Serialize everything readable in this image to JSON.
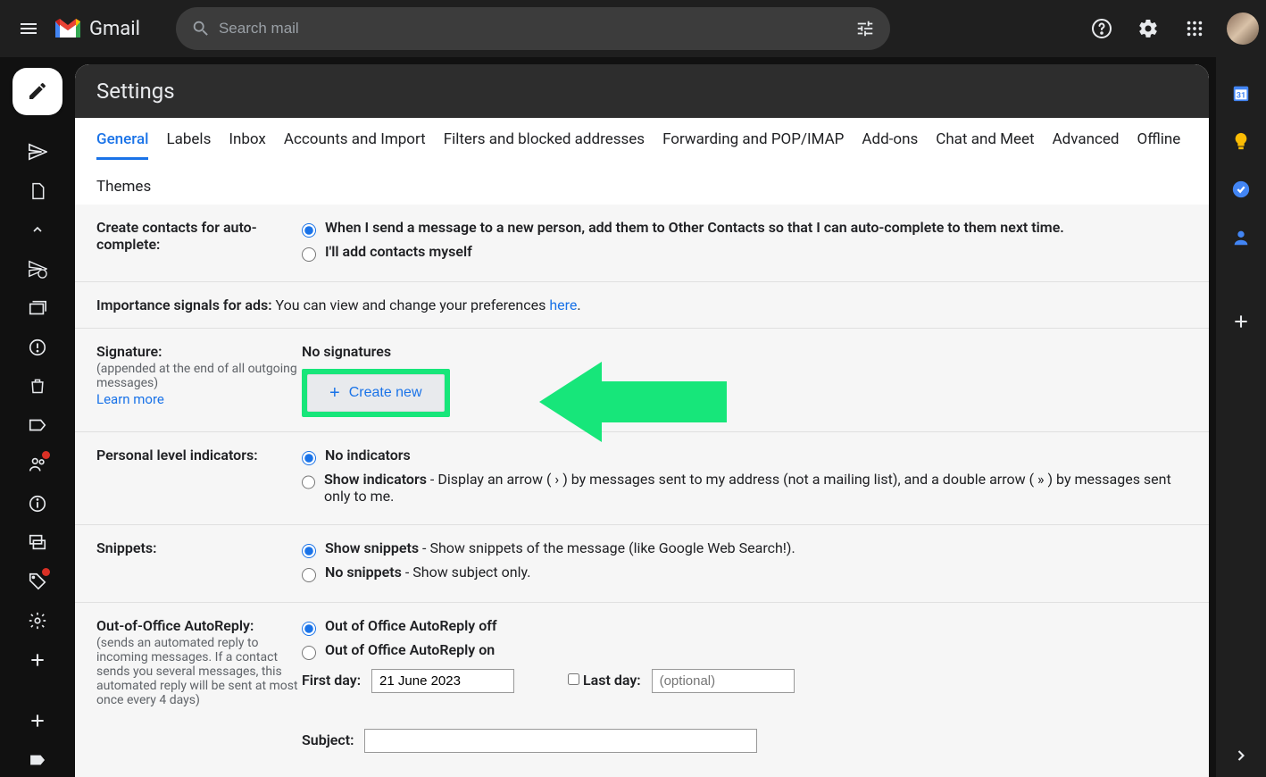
{
  "app": {
    "name": "Gmail"
  },
  "search": {
    "placeholder": "Search mail"
  },
  "page": {
    "title": "Settings"
  },
  "tabs": {
    "general": "General",
    "labels": "Labels",
    "inbox": "Inbox",
    "accounts": "Accounts and Import",
    "filters": "Filters and blocked addresses",
    "forwarding": "Forwarding and POP/IMAP",
    "addons": "Add-ons",
    "chat": "Chat and Meet",
    "advanced": "Advanced",
    "offline": "Offline",
    "themes": "Themes"
  },
  "settings": {
    "contacts": {
      "label": "Create contacts for auto-complete:",
      "opt1": "When I send a message to a new person, add them to Other Contacts so that I can auto-complete to them next time.",
      "opt2": "I'll add contacts myself"
    },
    "ads": {
      "label": "Importance signals for ads:",
      "text_pre": "You can view and change your preferences ",
      "link": "here",
      "text_post": "."
    },
    "signature": {
      "label": "Signature:",
      "sub": "(appended at the end of all outgoing messages)",
      "learn": "Learn more",
      "none": "No signatures",
      "create": "Create new"
    },
    "indicators": {
      "label": "Personal level indicators:",
      "opt1": "No indicators",
      "opt2_bold": "Show indicators",
      "opt2_rest": " - Display an arrow ( › ) by messages sent to my address (not a mailing list), and a double arrow ( » ) by messages sent only to me."
    },
    "snippets": {
      "label": "Snippets:",
      "opt1_bold": "Show snippets",
      "opt1_rest": " - Show snippets of the message (like Google Web Search!).",
      "opt2_bold": "No snippets",
      "opt2_rest": " - Show subject only."
    },
    "ooo": {
      "label": "Out-of-Office AutoReply:",
      "sub": "(sends an automated reply to incoming messages. If a contact sends you several messages, this automated reply will be sent at most once every 4 days)",
      "opt1": "Out of Office AutoReply off",
      "opt2": "Out of Office AutoReply on",
      "first_day_label": "First day:",
      "first_day_value": "21 June 2023",
      "last_day_label": "Last day:",
      "last_day_placeholder": "(optional)",
      "subject_label": "Subject:"
    }
  },
  "colors": {
    "accent": "#1a73e8",
    "highlight": "#17e67a"
  }
}
